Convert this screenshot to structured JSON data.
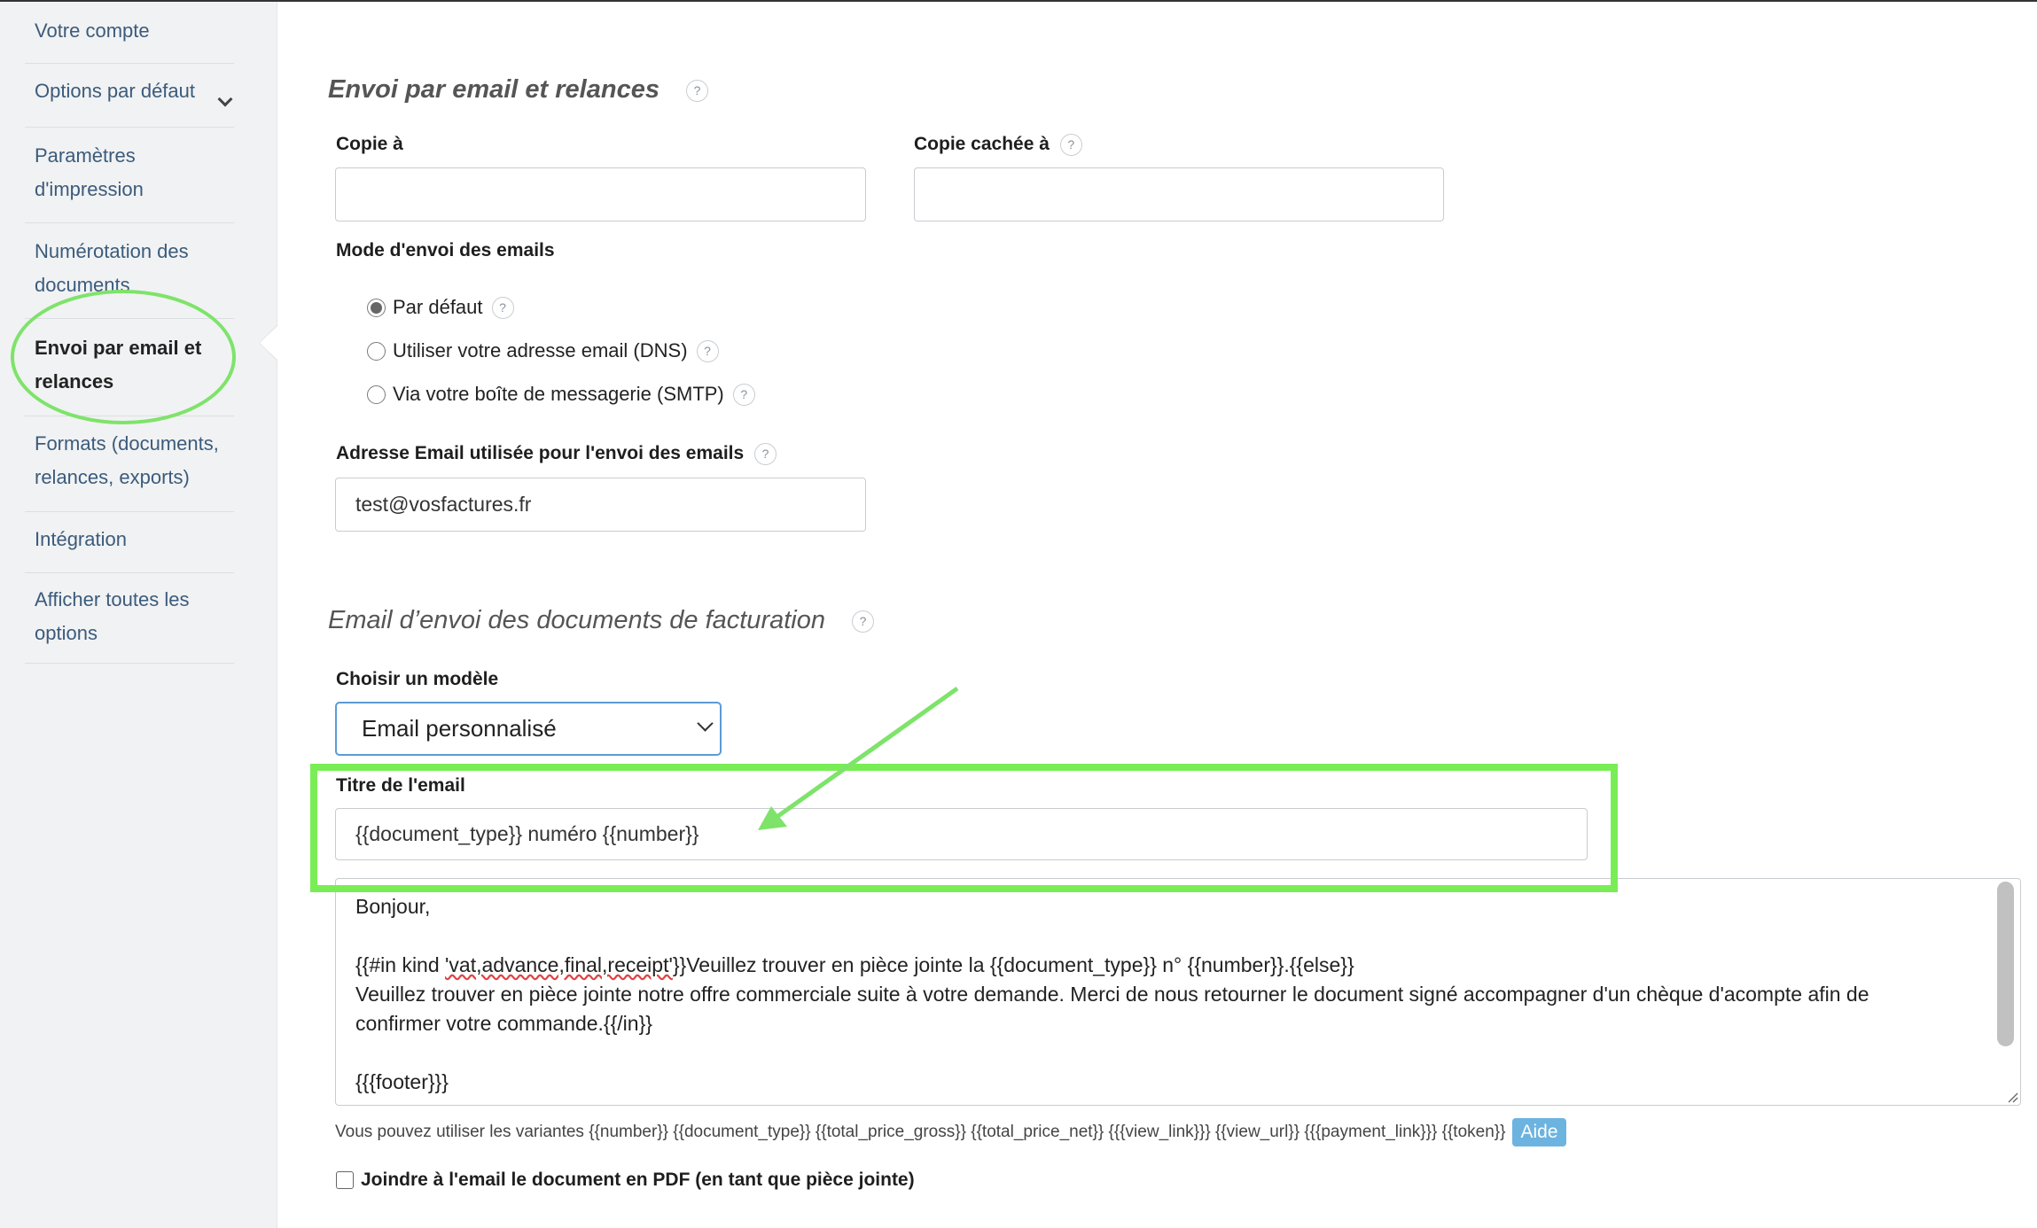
{
  "sidebar": {
    "items": [
      {
        "label_lines": [
          "Votre compte"
        ]
      },
      {
        "label_lines": [
          "Options par défaut"
        ]
      },
      {
        "label_lines": [
          "Paramètres",
          "d'impression"
        ]
      },
      {
        "label_lines": [
          "Numérotation des",
          "documents"
        ]
      },
      {
        "label_lines": [
          "Envoi par email et",
          "relances"
        ]
      },
      {
        "label_lines": [
          "Formats (documents,",
          "relances, exports)"
        ]
      },
      {
        "label_lines": [
          "Intégration"
        ]
      },
      {
        "label_lines": [
          "Afficher toutes les",
          "options"
        ]
      }
    ]
  },
  "section1": {
    "title": "Envoi par email et relances",
    "cc_label": "Copie à",
    "cc_value": "",
    "bcc_label": "Copie cachée à",
    "bcc_value": "",
    "mode_label": "Mode d'envoi des emails",
    "radio_options": [
      "Par défaut",
      "Utiliser votre adresse email (DNS)",
      "Via votre boîte de messagerie (SMTP)"
    ],
    "selected_radio": "Par défaut",
    "sender_label": "Adresse Email utilisée pour l'envoi des emails",
    "sender_value": "test@vosfactures.fr"
  },
  "section2": {
    "title": "Email d’envoi des documents de facturation",
    "template_label": "Choisir un modèle",
    "template_value": "Email personnalisé",
    "subject_label": "Titre de l'email",
    "subject_value": "{{document_type}} numéro {{number}}",
    "body": {
      "line1": "Bonjour,",
      "line2_prefix": "{{#in kind ",
      "line2_spell": "'vat,advance,final,receipt'",
      "line2_suffix": "}}Veuillez trouver en pièce jointe la {{document_type}} n° {{number}}.{{else}}",
      "line3": "Veuillez trouver en pièce jointe notre offre commerciale suite à votre demande. Merci de nous retourner le document signé accompagner d'un chèque d'acompte afin de",
      "line4": "confirmer votre commande.{{/in}}",
      "line5": "{{{footer}}}"
    },
    "variables_hint": "Vous pouvez utiliser les variantes {{number}} {{document_type}} {{total_price_gross}} {{total_price_net}} {{{view_link}}} {{view_url}} {{{payment_link}}} {{token}}",
    "help_label": "Aide",
    "attach_pdf_label": "Joindre à l'email le document en PDF (en tant que pièce jointe)",
    "attach_pdf_checked": false
  },
  "help_icon_text": "?",
  "annotation_color": "#7ee36a"
}
